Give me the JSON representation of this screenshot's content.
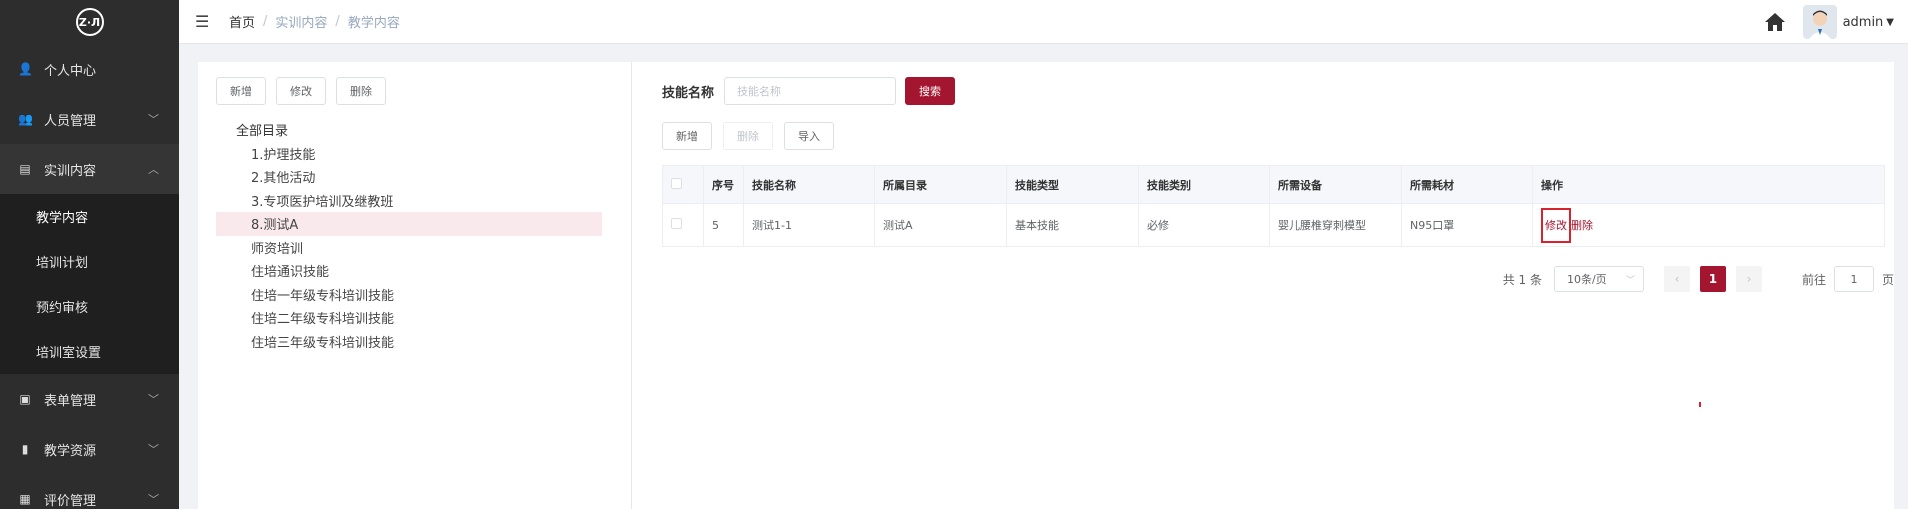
{
  "sidebar": {
    "logo_text": "Z·Л",
    "menu": [
      {
        "label": "个人中心",
        "icon": "user-icon"
      },
      {
        "label": "人员管理",
        "icon": "users-icon"
      },
      {
        "label": "实训内容",
        "icon": "book-icon"
      }
    ],
    "sub_items": [
      "教学内容",
      "培训计划",
      "预约审核",
      "培训室设置"
    ],
    "menu_after": [
      {
        "label": "表单管理",
        "icon": "form-icon"
      },
      {
        "label": "教学资源",
        "icon": "resource-icon"
      },
      {
        "label": "评价管理",
        "icon": "evaluation-icon"
      }
    ]
  },
  "header": {
    "breadcrumb": [
      "首页",
      "实训内容",
      "教学内容"
    ],
    "separator": "/",
    "username": "admin"
  },
  "left_toolbar": {
    "add": "新增",
    "edit": "修改",
    "delete": "删除"
  },
  "tree": {
    "root": "全部目录",
    "nodes": [
      "1.护理技能",
      "2.其他活动",
      "3.专项医护培训及继教班",
      "8.测试A",
      "师资培训",
      "住培通识技能",
      "住培一年级专科培训技能",
      "住培二年级专科培训技能",
      "住培三年级专科培训技能"
    ],
    "selected": "8.测试A"
  },
  "search": {
    "label": "技能名称",
    "placeholder": "技能名称",
    "button": "搜索"
  },
  "table_toolbar": {
    "add": "新增",
    "delete": "删除",
    "import": "导入"
  },
  "table": {
    "columns": [
      "序号",
      "技能名称",
      "所属目录",
      "技能类型",
      "技能类别",
      "所需设备",
      "所需耗材",
      "操作"
    ],
    "rows": [
      {
        "index": "5",
        "name": "测试1-1",
        "dir": "测试A",
        "type": "基本技能",
        "category": "必修",
        "equipment": "婴儿腰椎穿刺模型",
        "consumables": "N95口罩",
        "op_edit": "修改",
        "op_delete": "删除"
      }
    ]
  },
  "pager": {
    "total": "共 1 条",
    "page_size": "10条/页",
    "current": "1",
    "goto_prefix": "前往",
    "goto_value": "1",
    "goto_suffix": "页"
  },
  "colors": {
    "primary": "#a4152f",
    "highlight_border": "#d9222e",
    "sidebar_bg": "#2d2d2d"
  }
}
